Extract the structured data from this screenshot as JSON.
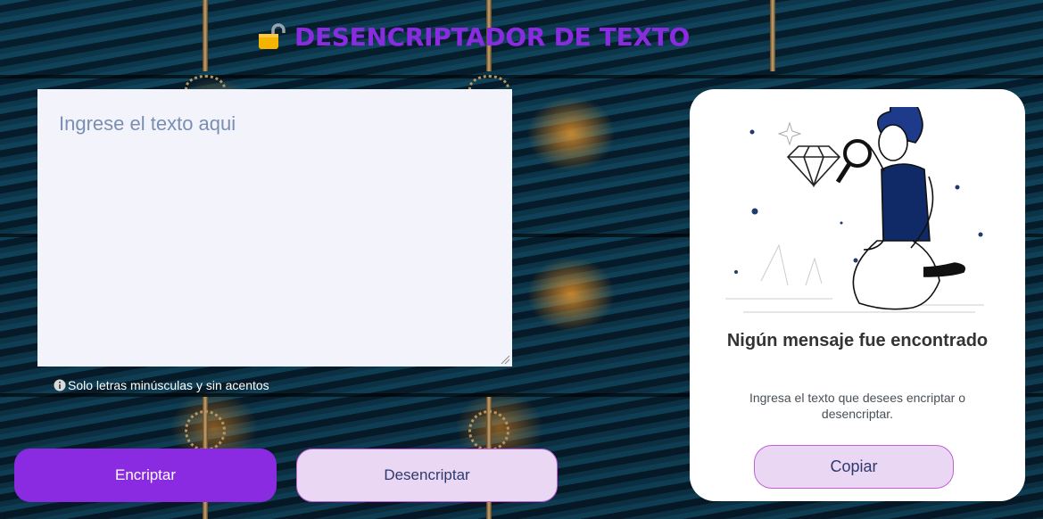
{
  "header": {
    "title": "DESENCRIPTADOR DE TEXTO",
    "icon": "lock-icon"
  },
  "input": {
    "placeholder": "Ingrese el texto aqui",
    "value": ""
  },
  "hint": {
    "icon": "info-icon",
    "text": "Solo letras minúsculas y sin acentos"
  },
  "actions": {
    "encrypt_label": "Encriptar",
    "decrypt_label": "Desencriptar"
  },
  "result": {
    "illustration": "searching-person-illustration",
    "title": "Nigún mensaje fue encontrado",
    "description": "Ingresa el texto que desees encriptar o desencriptar.",
    "copy_label": "Copiar"
  },
  "colors": {
    "accent": "#8a2be2",
    "secondary_button": "#ead7f3",
    "secondary_border": "#c35ed6",
    "input_bg": "#f3f3fb",
    "button_text_dark": "#2d3a6e"
  }
}
